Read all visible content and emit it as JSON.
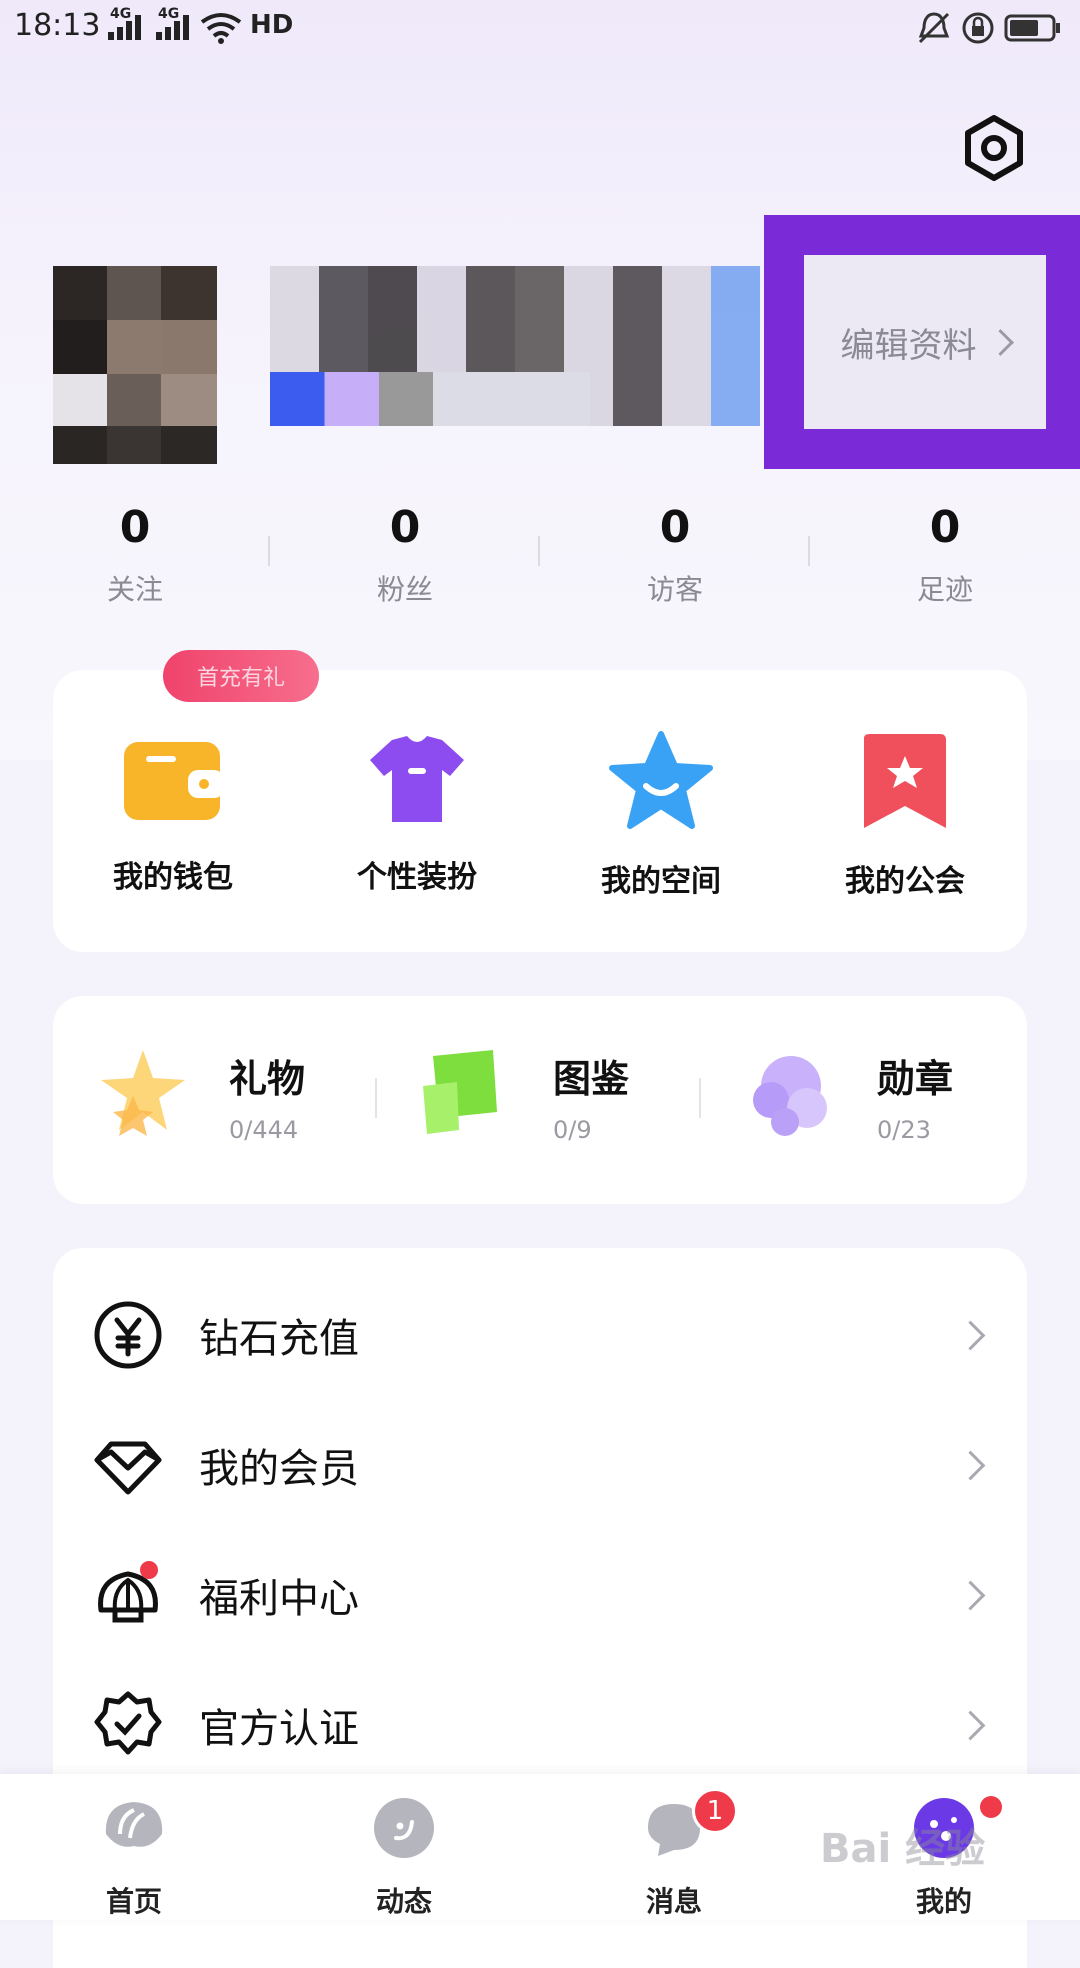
{
  "status_bar": {
    "time": "18:13",
    "network1": "4G",
    "network2": "4G",
    "hd": "HD",
    "icons": [
      "signal-icon",
      "wifi-icon",
      "mute-bell-icon",
      "rotation-lock-icon",
      "battery-icon"
    ]
  },
  "header": {
    "settings_icon": "settings-icon",
    "edit_profile_label": "编辑资料"
  },
  "stats": [
    {
      "value": "0",
      "label": "关注"
    },
    {
      "value": "0",
      "label": "粉丝"
    },
    {
      "value": "0",
      "label": "访客"
    },
    {
      "value": "0",
      "label": "足迹"
    }
  ],
  "quick_actions": {
    "badge": "首充有礼",
    "items": [
      {
        "label": "我的钱包",
        "icon": "wallet-icon"
      },
      {
        "label": "个性装扮",
        "icon": "outfit-icon"
      },
      {
        "label": "我的空间",
        "icon": "star-icon"
      },
      {
        "label": "我的公会",
        "icon": "guild-icon"
      }
    ]
  },
  "collections": [
    {
      "title": "礼物",
      "count": "0/444",
      "icon": "gift-star-icon"
    },
    {
      "title": "图鉴",
      "count": "0/9",
      "icon": "kite-icon"
    },
    {
      "title": "勋章",
      "count": "0/23",
      "icon": "puzzle-icon"
    }
  ],
  "menu": [
    {
      "label": "钻石充值",
      "icon": "yuan-icon"
    },
    {
      "label": "我的会员",
      "icon": "diamond-icon"
    },
    {
      "label": "福利中心",
      "icon": "shell-icon"
    },
    {
      "label": "官方认证",
      "icon": "badge-check-icon"
    }
  ],
  "bottom_nav": [
    {
      "label": "首页",
      "icon": "home-shell-icon"
    },
    {
      "label": "动态",
      "icon": "smile-icon"
    },
    {
      "label": "消息",
      "icon": "chat-icon",
      "badge": "1"
    },
    {
      "label": "我的",
      "icon": "profile-icon"
    }
  ],
  "watermark": "Bai 经验",
  "colors": {
    "highlight": "#7b2ad8",
    "badge_red": "#ef3a4a",
    "wallet": "#f8b52a",
    "outfit": "#8c4cf0",
    "space": "#3aa2f5",
    "guild": "#f0505c"
  }
}
